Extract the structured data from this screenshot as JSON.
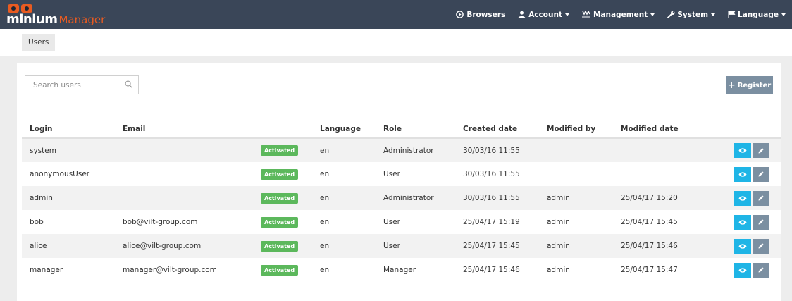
{
  "brand": {
    "strong": "minium",
    "light": "Manager"
  },
  "nav": {
    "browsers": {
      "label": "Browsers",
      "icon": "circle-play-icon"
    },
    "account": {
      "label": "Account",
      "icon": "user-icon"
    },
    "management": {
      "label": "Management",
      "icon": "management-icon"
    },
    "system": {
      "label": "System",
      "icon": "wrench-icon"
    },
    "language": {
      "label": "Language",
      "icon": "flag-icon"
    }
  },
  "breadcrumb": {
    "current": "Users"
  },
  "search": {
    "placeholder": "Search users",
    "value": ""
  },
  "register": {
    "label": "Register"
  },
  "table": {
    "headers": {
      "login": "Login",
      "email": "Email",
      "language": "Language",
      "role": "Role",
      "created": "Created date",
      "modified_by": "Modified by",
      "modified": "Modified date"
    },
    "rows": [
      {
        "login": "system",
        "email": "",
        "status": "Activated",
        "language": "en",
        "role": "Administrator",
        "created": "30/03/16 11:55",
        "modified_by": "",
        "modified": ""
      },
      {
        "login": "anonymousUser",
        "email": "",
        "status": "Activated",
        "language": "en",
        "role": "User",
        "created": "30/03/16 11:55",
        "modified_by": "",
        "modified": ""
      },
      {
        "login": "admin",
        "email": "",
        "status": "Activated",
        "language": "en",
        "role": "Administrator",
        "created": "30/03/16 11:55",
        "modified_by": "admin",
        "modified": "25/04/17 15:20"
      },
      {
        "login": "bob",
        "email": "bob@vilt-group.com",
        "status": "Activated",
        "language": "en",
        "role": "User",
        "created": "25/04/17 15:19",
        "modified_by": "admin",
        "modified": "25/04/17 15:45"
      },
      {
        "login": "alice",
        "email": "alice@vilt-group.com",
        "status": "Activated",
        "language": "en",
        "role": "User",
        "created": "25/04/17 15:45",
        "modified_by": "admin",
        "modified": "25/04/17 15:46"
      },
      {
        "login": "manager",
        "email": "manager@vilt-group.com",
        "status": "Activated",
        "language": "en",
        "role": "Manager",
        "created": "25/04/17 15:46",
        "modified_by": "admin",
        "modified": "25/04/17 15:47"
      }
    ]
  },
  "colors": {
    "navbar": "#3a4658",
    "brand_accent": "#e85b21",
    "status_activated": "#5cb85c",
    "view_button": "#1fb5e6",
    "edit_button": "#7b8fa1"
  }
}
